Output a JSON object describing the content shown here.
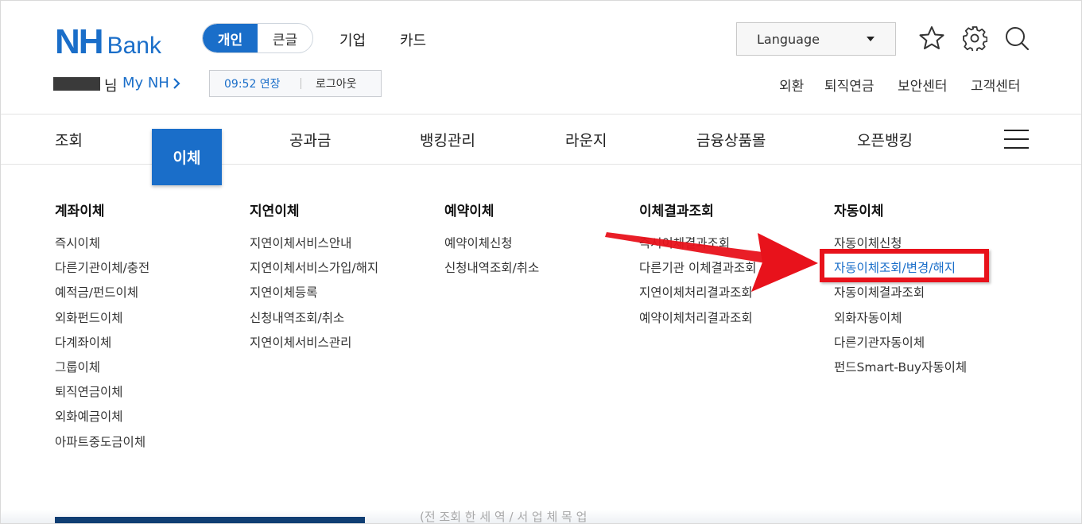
{
  "header": {
    "logo_primary": "NH",
    "logo_secondary": "Bank",
    "segment": [
      {
        "label": "개인",
        "active": true
      },
      {
        "label": "큰글",
        "active": false
      }
    ],
    "links": [
      "기업",
      "카드"
    ],
    "language_label": "Language",
    "icons": [
      "star-icon",
      "gear-icon",
      "search-icon"
    ]
  },
  "user": {
    "name_suffix": "님",
    "mynh_label": "My NH",
    "session_time": "09:52 연장",
    "logout_label": "로그아웃"
  },
  "util_links": [
    "외환",
    "퇴직연금",
    "보안센터",
    "고객센터"
  ],
  "gnb": {
    "items": [
      "조회",
      "이체",
      "공과금",
      "뱅킹관리",
      "라운지",
      "금융상품몰",
      "오픈뱅킹"
    ],
    "active": "이체"
  },
  "menu": [
    {
      "title": "계좌이체",
      "items": [
        "즉시이체",
        "다른기관이체/충전",
        "예적금/펀드이체",
        "외화펀드이체",
        "다계좌이체",
        "그룹이체",
        "퇴직연금이체",
        "외화예금이체",
        "아파트중도금이체"
      ]
    },
    {
      "title": "지연이체",
      "items": [
        "지연이체서비스안내",
        "지연이체서비스가입/해지",
        "지연이체등록",
        "신청내역조회/취소",
        "지연이체서비스관리"
      ]
    },
    {
      "title": "예약이체",
      "items": [
        "예약이체신청",
        "신청내역조회/취소"
      ]
    },
    {
      "title": "이체결과조회",
      "items": [
        "즉시이체결과조회",
        "다른기관 이체결과조회",
        "지연이체처리결과조회",
        "예약이체처리결과조회"
      ]
    },
    {
      "title": "자동이체",
      "items": [
        "자동이체신청",
        "자동이체조회/변경/해지",
        "자동이체결과조회",
        "외화자동이체",
        "다른기관자동이체",
        "펀드Smart-Buy자동이체"
      ]
    }
  ],
  "highlighted_item": "자동이체조회/변경/해지",
  "annotation": {
    "color": "#e8121b"
  },
  "colors": {
    "brand": "#1a6ec9",
    "highlight": "#e8121b"
  },
  "bottom_peek": "(전 조회 한 세 역 / 서 업 체 목 업"
}
